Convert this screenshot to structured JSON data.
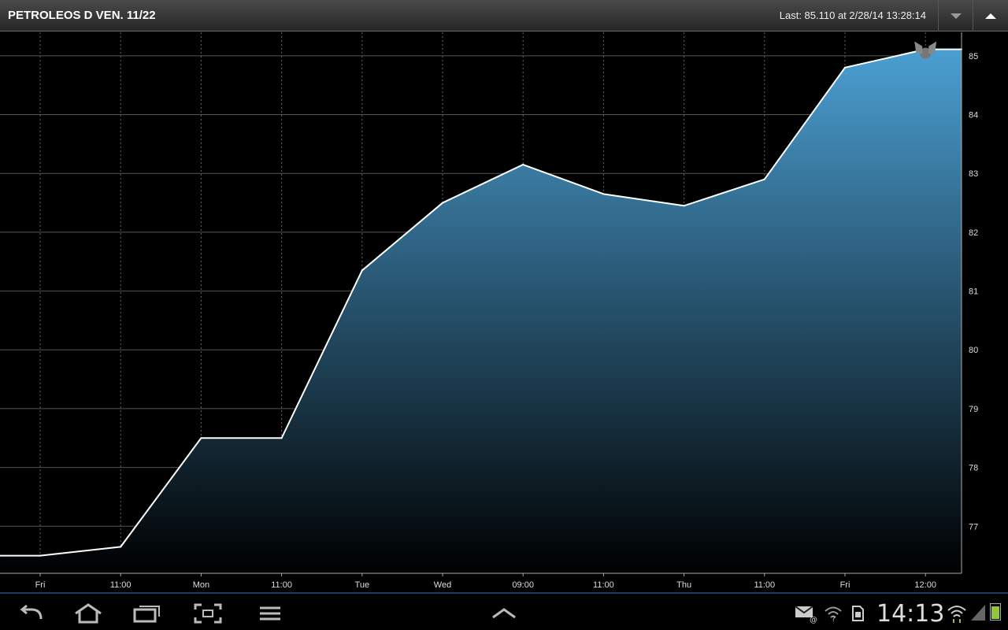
{
  "window": {
    "title": "PETROLEOS D VEN. 11/22",
    "last_quote": "Last: 85.110 at 2/28/14 13:28:14"
  },
  "status_bar": {
    "clock": "14:13"
  },
  "icons": {
    "dropdown": "chevron-down-icon",
    "collapse": "chevron-up-icon",
    "back": "back-icon",
    "home": "home-icon",
    "recent": "recent-apps-icon",
    "screenshot": "screenshot-icon",
    "menu": "menu-icon",
    "up": "chevron-up-icon",
    "notification": "email-notification-icon",
    "wifi": "wifi-icon",
    "sd": "sd-card-icon",
    "signal": "signal-icon",
    "battery": "battery-icon",
    "marker": "last-price-marker-icon"
  },
  "colors": {
    "line": "#ffffff",
    "fill_top": "#4b9fd2",
    "fill_bottom": "#000000",
    "grid": "#555555",
    "battery": "#8ec63f"
  },
  "chart_data": {
    "type": "area",
    "x_ticks": [
      "Fri",
      "11:00",
      "Mon",
      "11:00",
      "Tue",
      "Wed",
      "09:00",
      "11:00",
      "Thu",
      "11:00",
      "Fri",
      "12:00"
    ],
    "ylim": [
      76.2,
      85.4
    ],
    "y_ticks": [
      77,
      78,
      79,
      80,
      81,
      82,
      83,
      84,
      85
    ],
    "y_axis_position": "right",
    "grid": true,
    "series": [
      {
        "x": [
          -0.5,
          0,
          1,
          2,
          3,
          4,
          5,
          6,
          7,
          8,
          9,
          10,
          11,
          11.5
        ],
        "values": [
          76.5,
          76.5,
          76.65,
          78.5,
          78.5,
          81.35,
          82.5,
          83.15,
          82.65,
          82.45,
          82.9,
          84.8,
          85.11,
          85.11
        ]
      }
    ],
    "last_value": 85.11
  }
}
